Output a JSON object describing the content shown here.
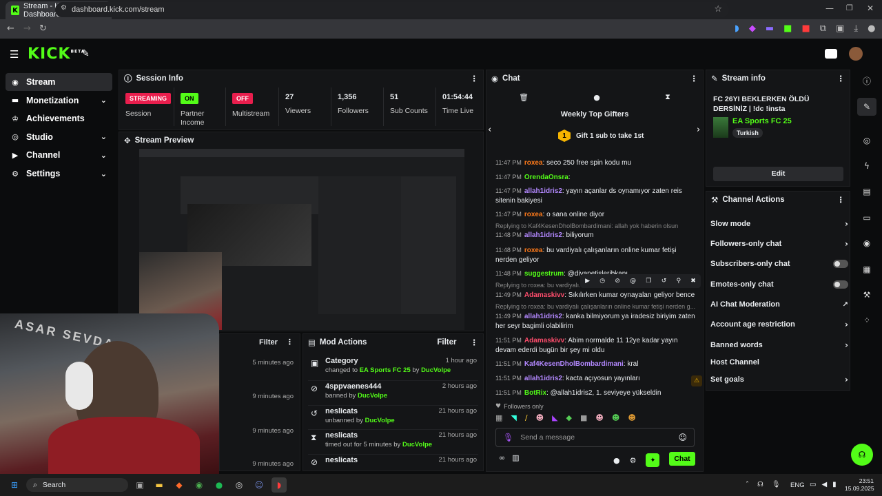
{
  "browser": {
    "tab_title": "Stream - Kick Dashboard",
    "url": "dashboard.kick.com/stream",
    "new_tab": "+"
  },
  "app": {
    "logo": "KICK",
    "logo_sup": "BETA"
  },
  "sidebar": {
    "items": [
      {
        "label": "Stream",
        "icon": "stream-icon",
        "active": true
      },
      {
        "label": "Monetization",
        "icon": "monetization-icon",
        "expandable": true
      },
      {
        "label": "Achievements",
        "icon": "trophy-icon"
      },
      {
        "label": "Studio",
        "icon": "studio-icon",
        "expandable": true
      },
      {
        "label": "Channel",
        "icon": "channel-icon",
        "expandable": true
      },
      {
        "label": "Settings",
        "icon": "gear-icon",
        "expandable": true
      }
    ]
  },
  "session": {
    "title": "Session Info",
    "stats": [
      {
        "badge": "STREAMING",
        "label": "Session",
        "badge_color": "#e91e4d"
      },
      {
        "badge": "ON",
        "label": "Partner Income",
        "badge_color": "#53fc18"
      },
      {
        "badge": "OFF",
        "label": "Multistream",
        "badge_color": "#e91e4d"
      },
      {
        "value": "27",
        "label": "Viewers"
      },
      {
        "value": "1,356",
        "label": "Followers"
      },
      {
        "value": "51",
        "label": "Sub Counts"
      },
      {
        "value": "01:54:44",
        "label": "Time Live"
      }
    ]
  },
  "preview": {
    "title": "Stream Preview"
  },
  "left_bottom": {
    "filter": "Filter",
    "times": [
      "5 minutes ago",
      "9 minutes ago",
      "9 minutes ago",
      "9 minutes ago"
    ]
  },
  "mod_actions": {
    "title": "Mod Actions",
    "filter": "Filter",
    "items": [
      {
        "title": "Category",
        "sub_pre": "changed to ",
        "sub_hl": "EA Sports FC 25",
        "sub_mid": " by ",
        "sub_user": "DucVolpe",
        "time": "1 hour ago",
        "icon": "category-icon"
      },
      {
        "title": "4sppvaenes444",
        "sub_pre": "banned by ",
        "sub_hl": "",
        "sub_mid": "",
        "sub_user": "DucVolpe",
        "time": "2 hours ago",
        "icon": "ban-icon"
      },
      {
        "title": "neslicats",
        "sub_pre": "unbanned by ",
        "sub_hl": "",
        "sub_mid": "",
        "sub_user": "DucVolpe",
        "time": "21 hours ago",
        "icon": "unban-icon"
      },
      {
        "title": "neslicats",
        "sub_pre": "timed out for 5 minutes by ",
        "sub_hl": "",
        "sub_mid": "",
        "sub_user": "DucVolpe",
        "time": "21 hours ago",
        "icon": "hourglass-icon"
      },
      {
        "title": "neslicats",
        "sub_pre": "",
        "sub_hl": "",
        "sub_mid": "",
        "sub_user": "",
        "time": "21 hours ago",
        "icon": "ban-icon"
      }
    ]
  },
  "chat": {
    "title": "Chat",
    "gifters_title": "Weekly Top Gifters",
    "gift_text": "Gift 1 sub to take 1st",
    "gift_rank": "1",
    "messages": [
      {
        "time": "11:47 PM",
        "user": "roxea",
        "color": "#ff7a1a",
        "text": "seco 250 free spin kodu mu"
      },
      {
        "time": "11:47 PM",
        "user": "OrendaOnsra",
        "color": "#53fc18",
        "text": ""
      },
      {
        "time": "11:47 PM",
        "user": "allah1idris2",
        "color": "#b388ff",
        "text": "yayın açanlar ds oynamıyor zaten reis sitenin bakiyesi"
      },
      {
        "time": "11:47 PM",
        "user": "roxea",
        "color": "#ff7a1a",
        "text": "o sana online diyor"
      },
      {
        "time": "11:48 PM",
        "user": "allah1idris2",
        "color": "#b388ff",
        "text": "biliyorum",
        "reply": "Replying to Kaf4KesenDholBombardimani: allah yok haberin olsun"
      },
      {
        "time": "11:48 PM",
        "user": "roxea",
        "color": "#ff7a1a",
        "text": "bu vardiyalı çalışanların online kumar fetişi nerden geliyor"
      },
      {
        "time": "11:48 PM",
        "user": "suggestrum",
        "color": "#53fc18",
        "text": "@diyanetisleribkanı"
      },
      {
        "time": "11:49 PM",
        "user": "Adamaskivv",
        "color": "#ff4d6d",
        "text": "Sıkılırken kumar oynayaları geliyor bence",
        "reply": "Replying to roxea: bu vardiyalı..."
      },
      {
        "time": "11:49 PM",
        "user": "allah1idris2",
        "color": "#b388ff",
        "text": "kanka bilmiyorum ya iradesiz biriyim zaten her seyr bagimli olabilirim",
        "reply": "Replying to roxea: bu vardiyalı çalışanların online kumar fetişi nerden g..."
      },
      {
        "time": "11:51 PM",
        "user": "Adamaskivv",
        "color": "#ff4d6d",
        "text": "Abim normalde 11 12ye kadar yayın devam ederdi bugün bir şey mi oldu"
      },
      {
        "time": "11:51 PM",
        "user": "Kaf4KesenDholBombardimani",
        "color": "#b388ff",
        "text": "kral"
      },
      {
        "time": "11:51 PM",
        "user": "allah1idris2",
        "color": "#b388ff",
        "text": "kacta açıyosun yayınları"
      },
      {
        "time": "11:51 PM",
        "user": "BotRix",
        "color": "#53fc18",
        "text": "@allah1idris2, 1. seviyeye yükseldin"
      }
    ],
    "followers_only": "Followers only",
    "input_placeholder": "Send a message",
    "send_label": "Chat"
  },
  "stream_info": {
    "title": "Stream info",
    "stream_title": "FC 26YI BEKLERKEN ÖLDÜ DERSİNİZ | !dc !insta",
    "category": "EA Sports FC 25",
    "language": "Turkish",
    "edit_label": "Edit"
  },
  "channel_actions": {
    "title": "Channel Actions",
    "items": [
      {
        "label": "Slow mode",
        "type": "arrow"
      },
      {
        "label": "Followers-only chat",
        "type": "arrow"
      },
      {
        "label": "Subscribers-only chat",
        "type": "toggle"
      },
      {
        "label": "Emotes-only chat",
        "type": "toggle"
      },
      {
        "label": "AI Chat Moderation",
        "type": "external"
      },
      {
        "label": "Account age restriction",
        "type": "arrow"
      },
      {
        "label": "Banned words",
        "type": "arrow"
      },
      {
        "label": "Host Channel",
        "type": "none"
      },
      {
        "label": "Set goals",
        "type": "arrow"
      }
    ]
  },
  "taskbar": {
    "search": "Search",
    "lang": "ENG",
    "time": "23:51",
    "date": "15.09.2025"
  },
  "colors": {
    "accent": "#53fc18",
    "live": "#e91e4d"
  }
}
